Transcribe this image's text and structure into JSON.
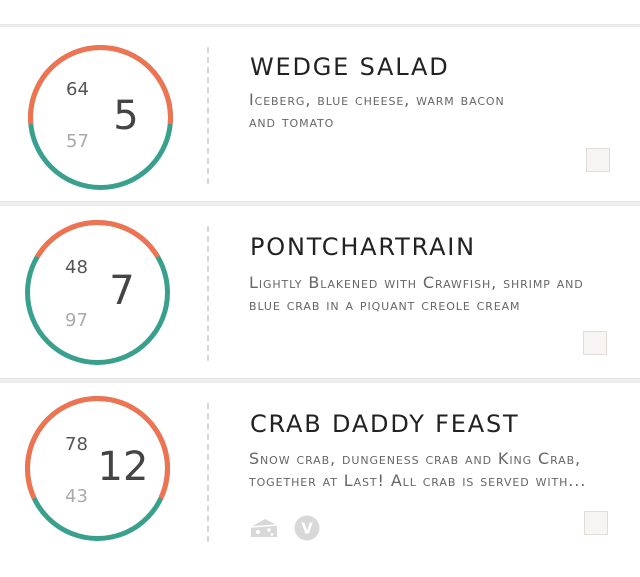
{
  "colors": {
    "arc_top": "#ef7350",
    "arc_bottom": "#3aa08e",
    "divider": "#d6d6d6",
    "icon_gray": "#d8d8d8"
  },
  "menu_items": [
    {
      "title": "WEDGE SALAD",
      "description": "Iceberg, blue cheese, warm bacon and tomato",
      "gauge": {
        "top_value": "64",
        "bottom_value": "57",
        "main_value": "5",
        "top_fraction": 0.53
      }
    },
    {
      "title": "PONTCHARTRAIN",
      "description": "Lightly Blakened with Crawfish, shrimp and blue crab in a piquant creole cream",
      "gauge": {
        "top_value": "48",
        "bottom_value": "97",
        "main_value": "7",
        "top_fraction": 0.33
      }
    },
    {
      "title": "CRAB DADDY FEAST",
      "description_lines": [
        "Snow crab, dungeness crab and King Crab,",
        "together at Last! All crab is served with..."
      ],
      "gauge": {
        "top_value": "78",
        "bottom_value": "43",
        "main_value": "12",
        "top_fraction": 0.64
      },
      "diet_icons": [
        "cheese-icon",
        "vegetarian-v-icon"
      ],
      "diet_icon_letter": "V"
    }
  ]
}
